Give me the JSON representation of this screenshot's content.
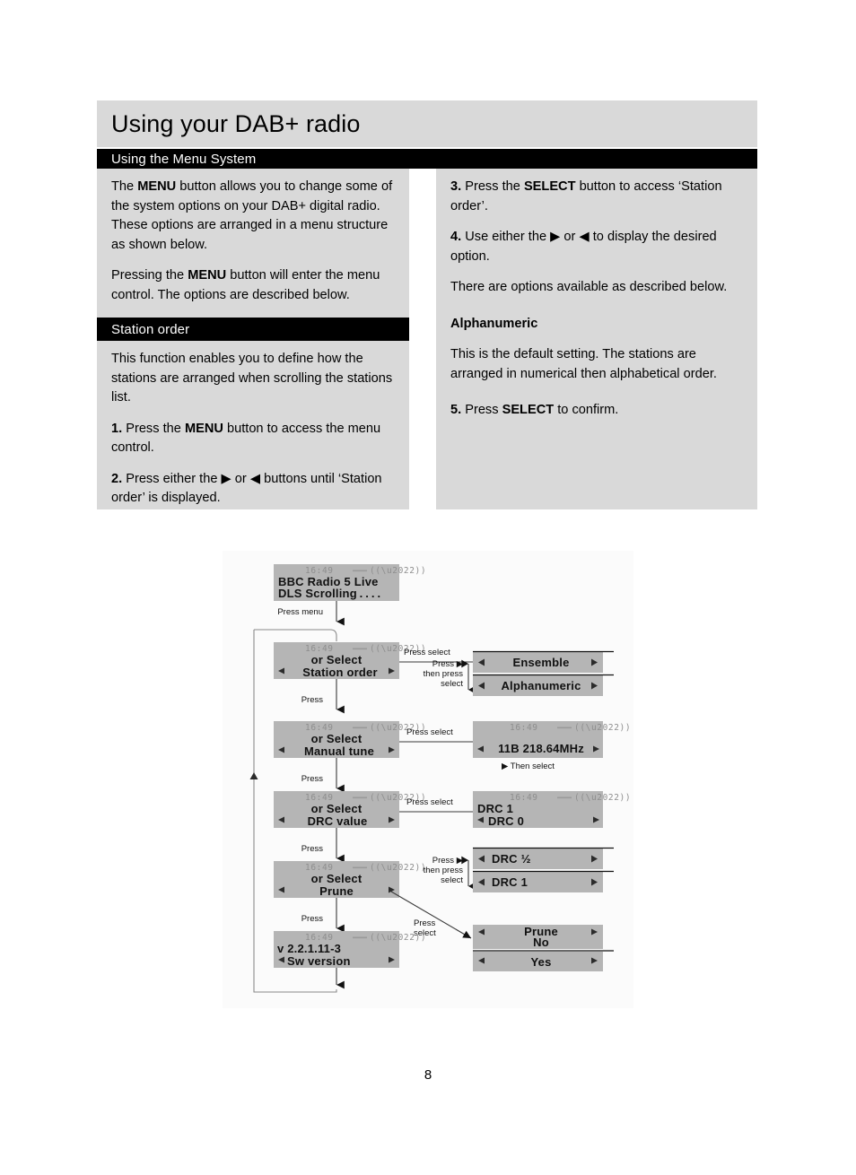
{
  "page": {
    "title": "Using your DAB+ radio",
    "number": "8"
  },
  "sections": {
    "menu_system": "Using the Menu System",
    "station_order": "Station order"
  },
  "left_column": {
    "paragraphs": [
      {
        "runs": [
          {
            "t": "The ",
            "b": false
          },
          {
            "t": "MENU",
            "b": true
          },
          {
            "t": " button allows you to change some of the system options on your DAB+ digital radio. These options are arranged in a menu structure as shown below.",
            "b": false
          }
        ]
      },
      {
        "runs": [
          {
            "t": "Pressing the ",
            "b": false
          },
          {
            "t": "MENU",
            "b": true
          },
          {
            "t": " button will enter the menu control. The options are described below.",
            "b": false
          }
        ]
      }
    ],
    "station_order_paragraphs": [
      {
        "runs": [
          {
            "t": "This function enables you to define how the stations are arranged when scrolling the stations list.",
            "b": false
          }
        ]
      },
      {
        "runs": [
          {
            "t": "1.",
            "b": true
          },
          {
            "t": " Press the ",
            "b": false
          },
          {
            "t": "MENU",
            "b": true
          },
          {
            "t": " button to access the menu control.",
            "b": false
          }
        ]
      },
      {
        "runs": [
          {
            "t": "2.",
            "b": true
          },
          {
            "t": " Press either the ",
            "b": false
          },
          {
            "t": "▶",
            "b": false
          },
          {
            "t": " or ",
            "b": false
          },
          {
            "t": "◀",
            "b": false
          },
          {
            "t": " buttons until ‘Station order’ is displayed.",
            "b": false
          }
        ]
      }
    ]
  },
  "right_column": {
    "paragraphs": [
      {
        "runs": [
          {
            "t": "3.",
            "b": true
          },
          {
            "t": " Press the ",
            "b": false
          },
          {
            "t": "SELECT",
            "b": true
          },
          {
            "t": " button to access ‘Station order’.",
            "b": false
          }
        ]
      },
      {
        "runs": [
          {
            "t": "4.",
            "b": true
          },
          {
            "t": " Use either the ",
            "b": false
          },
          {
            "t": "▶",
            "b": false
          },
          {
            "t": " or ",
            "b": false
          },
          {
            "t": "◀",
            "b": false
          },
          {
            "t": " to display the desired option.",
            "b": false
          }
        ]
      },
      {
        "runs": [
          {
            "t": "There are options available as described below.",
            "b": false
          }
        ]
      }
    ],
    "alphanumeric_heading": "Alphanumeric",
    "alphanumeric_body": {
      "runs": [
        {
          "t": "This is the default setting. The stations are arranged in numerical then alphabetical order.",
          "b": false
        }
      ]
    },
    "step5": {
      "runs": [
        {
          "t": "5.",
          "b": true
        },
        {
          "t": " Press ",
          "b": false
        },
        {
          "t": "SELECT",
          "b": true
        },
        {
          "t": " to confirm.",
          "b": false
        }
      ]
    }
  },
  "chart_data": {
    "type": "diagram",
    "title": "DAB+ radio menu structure flow chart",
    "clock": "16:49",
    "nodes": [
      {
        "id": "now_playing",
        "line1": "BBC Radio 5 Live",
        "line2": "DLS Scrolling . . . .",
        "header": true,
        "left_arrow": false,
        "right_arrow": false,
        "align": "left"
      },
      {
        "id": "station_order",
        "line1": "or Select",
        "line2": "Station order",
        "header": true,
        "left_arrow": true,
        "right_arrow": true,
        "align": "center"
      },
      {
        "id": "manual_tune",
        "line1": "or Select",
        "line2": "Manual tune",
        "header": true,
        "left_arrow": true,
        "right_arrow": true,
        "align": "center"
      },
      {
        "id": "drc_value",
        "line1": "or Select",
        "line2": "DRC value",
        "header": true,
        "left_arrow": true,
        "right_arrow": true,
        "align": "center"
      },
      {
        "id": "prune",
        "line1": "or Select",
        "line2": "Prune",
        "header": true,
        "left_arrow": true,
        "right_arrow": true,
        "align": "center"
      },
      {
        "id": "sw_version",
        "line1": "v 2.2.1.11-3",
        "line2": "Sw version",
        "header": true,
        "left_arrow": true,
        "right_arrow": true,
        "align": "left"
      }
    ],
    "options": [
      {
        "id": "ensemble",
        "label": "Ensemble"
      },
      {
        "id": "alphanumeric",
        "label": "Alphanumeric"
      },
      {
        "id": "manual_tune_value",
        "line2": "11B  218.64MHz",
        "header": true
      },
      {
        "id": "drc1_top",
        "label": "DRC 1",
        "plain_top": true
      },
      {
        "id": "drc0",
        "label": "DRC 0"
      },
      {
        "id": "drc_half",
        "label": "DRC ½"
      },
      {
        "id": "drc1",
        "label": "DRC 1"
      },
      {
        "id": "prune_no",
        "label_top": "Prune",
        "label": "No"
      },
      {
        "id": "prune_yes",
        "label": "Yes"
      }
    ],
    "edge_labels": [
      "Press menu",
      "Press select",
      "Press ▶\nthen press\nselect",
      "Press",
      "Press select",
      "▶ Then select",
      "Press select",
      "Press",
      "Press ▶\nthen press\nselect",
      "Press select",
      "Press"
    ],
    "labels": {
      "press_menu": "Press menu",
      "press_select": "Press select",
      "press": "Press",
      "press_right_then_select_l1": "Press ▶",
      "press_right_then_select_l2": "then press",
      "press_right_then_select_l3": "select",
      "then_select": "▶ Then select",
      "press_select_l1": "Press",
      "press_select_l2": "select"
    }
  }
}
